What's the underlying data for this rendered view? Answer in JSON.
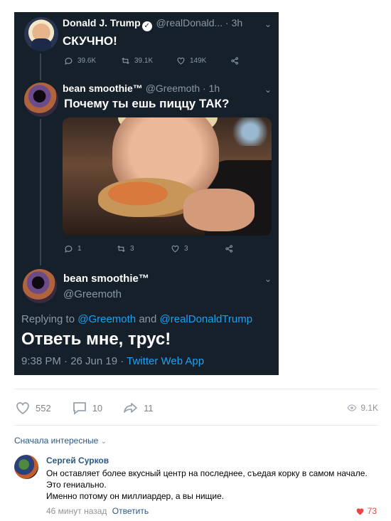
{
  "tweet1": {
    "name": "Donald J. Trump",
    "handle_time": "@realDonald... · 3h",
    "text": "СКУЧНО!",
    "replies": "39.6K",
    "retweets": "39.1K",
    "likes": "149K"
  },
  "tweet2": {
    "name": "bean smoothie™",
    "handle_time": "@Greemoth · 1h",
    "text": "Почему ты ешь пиццу ТАК?",
    "replies": "1",
    "retweets": "3",
    "likes": "3"
  },
  "tweet3": {
    "name": "bean smoothie™",
    "handle": "@Greemoth",
    "replying_prefix": "Replying to",
    "mention1": "@Greemoth",
    "replying_and": "and",
    "mention2": "@realDonaldTrump",
    "text": "Ответь мне, трус!",
    "timestamp": "9:38 PM · 26 Jun 19 ·",
    "app": "Twitter Web App"
  },
  "post_actions": {
    "likes": "552",
    "comments": "10",
    "shares": "11",
    "views": "9.1K"
  },
  "comments": {
    "sort_label": "Сначала интересные",
    "items": [
      {
        "author": "Сергей Сурков",
        "line1": "Он оставляет более вкусный центр на последнее, съедая корку в самом начале. Это гениально.",
        "line2": "Именно потому он миллиардер, а вы нищие.",
        "time": "46 минут назад",
        "reply_label": "Ответить",
        "likes": "73"
      }
    ]
  },
  "colors": {
    "tweet_bg": "#15202b",
    "tweet_link": "#1da1f2",
    "vk_link": "#2a5885",
    "vk_like": "#e64646"
  }
}
